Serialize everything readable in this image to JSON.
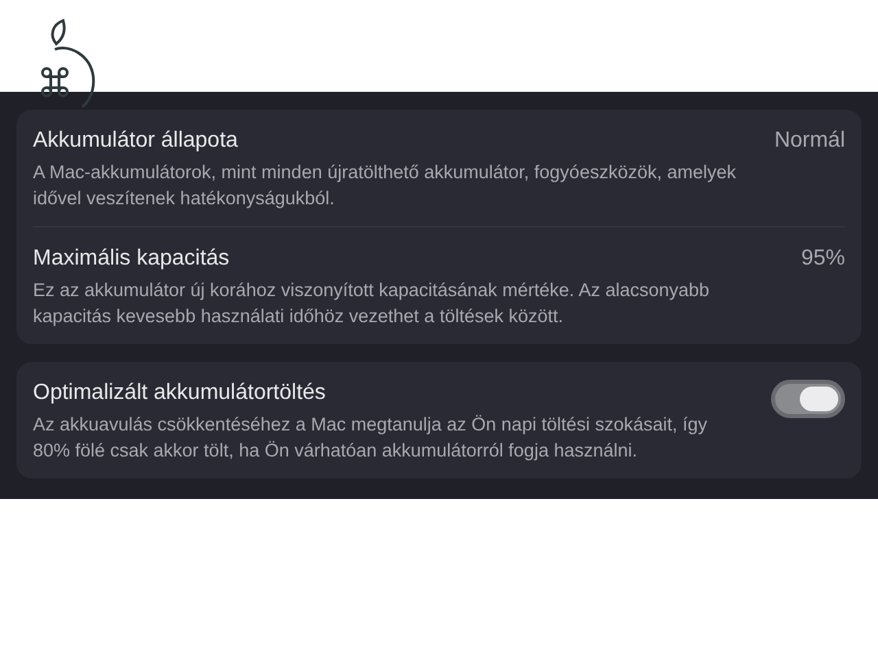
{
  "cards": [
    {
      "rows": [
        {
          "title": "Akkumulátor állapota",
          "description": "A Mac-akkumulátorok, mint minden újratölthető akkumulátor, fogyóeszközök, amelyek idővel veszítenek hatékonyságukból.",
          "kind": "value",
          "value": "Normál"
        },
        {
          "title": "Maximális kapacitás",
          "description": "Ez az akkumulátor új korához viszonyított kapacitásának mértéke. Az alacsonyabb kapacitás kevesebb használati időhöz vezethet a töltések között.",
          "kind": "value",
          "value": "95%"
        }
      ]
    },
    {
      "rows": [
        {
          "title": "Optimalizált akkumulátortöltés",
          "description": "Az akkuavulás csökkentéséhez a Mac megtanulja az Ön napi töltési szokásait, így 80% fölé csak akkor tölt, ha Ön várhatóan akkumulátorról fogja használni.",
          "kind": "toggle",
          "on": true
        }
      ]
    }
  ]
}
